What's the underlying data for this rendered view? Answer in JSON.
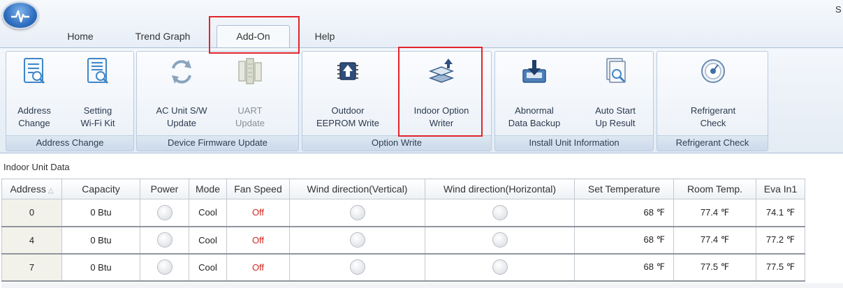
{
  "app": {
    "orb_icon": "heartbeat-icon",
    "corner_text": "S"
  },
  "tabs": [
    {
      "label": "Home",
      "active": false
    },
    {
      "label": "Trend Graph",
      "active": false
    },
    {
      "label": "Add-On",
      "active": true
    },
    {
      "label": "Help",
      "active": false
    }
  ],
  "ribbon": {
    "groups": [
      {
        "label": "Address Change",
        "buttons": [
          {
            "line1": "Address",
            "line2": "Change",
            "icon": "address-change-icon",
            "enabled": true
          },
          {
            "line1": "Setting",
            "line2": "Wi-Fi Kit",
            "icon": "wifi-kit-icon",
            "enabled": true
          }
        ]
      },
      {
        "label": "Device Firmware Update",
        "buttons": [
          {
            "line1": "AC Unit S/W",
            "line2": "Update",
            "icon": "sync-arrows-icon",
            "enabled": true
          },
          {
            "line1": "UART",
            "line2": "Update",
            "icon": "uart-chip-icon",
            "enabled": false
          }
        ]
      },
      {
        "label": "Option Write",
        "buttons": [
          {
            "line1": "Outdoor",
            "line2": "EEPROM Write",
            "icon": "eeprom-chip-icon",
            "enabled": true
          },
          {
            "line1": "Indoor Option",
            "line2": "Writer",
            "icon": "layers-upload-icon",
            "enabled": true
          }
        ]
      },
      {
        "label": "Install Unit Information",
        "buttons": [
          {
            "line1": "Abnormal",
            "line2": "Data Backup",
            "icon": "download-tray-icon",
            "enabled": true
          },
          {
            "line1": "Auto Start",
            "line2": "Up Result",
            "icon": "report-search-icon",
            "enabled": true
          }
        ]
      },
      {
        "label": "Refrigerant Check",
        "buttons": [
          {
            "line1": "Refrigerant",
            "line2": "Check",
            "icon": "gauge-icon",
            "enabled": true
          }
        ]
      }
    ]
  },
  "section_title": "Indoor Unit Data",
  "table": {
    "columns": [
      "Address",
      "Capacity",
      "Power",
      "Mode",
      "Fan Speed",
      "Wind direction(Vertical)",
      "Wind direction(Horizontal)",
      "Set Temperature",
      "Room Temp.",
      "Eva In1"
    ],
    "sort_indicator": "△",
    "rows": [
      {
        "address": "0",
        "capacity": "0 Btu",
        "mode": "Cool",
        "fan_speed": "Off",
        "set_temp": "68 ℉",
        "room_temp": "77.4 ℉",
        "eva_in1": "74.1 ℉"
      },
      {
        "address": "4",
        "capacity": "0 Btu",
        "mode": "Cool",
        "fan_speed": "Off",
        "set_temp": "68 ℉",
        "room_temp": "77.4 ℉",
        "eva_in1": "77.2 ℉"
      },
      {
        "address": "7",
        "capacity": "0 Btu",
        "mode": "Cool",
        "fan_speed": "Off",
        "set_temp": "68 ℉",
        "room_temp": "77.5 ℉",
        "eva_in1": "77.5 ℉"
      }
    ]
  },
  "colors": {
    "highlight": "#e2242a",
    "fan_off": "#d6261f",
    "accent": "#2f6fc0"
  }
}
